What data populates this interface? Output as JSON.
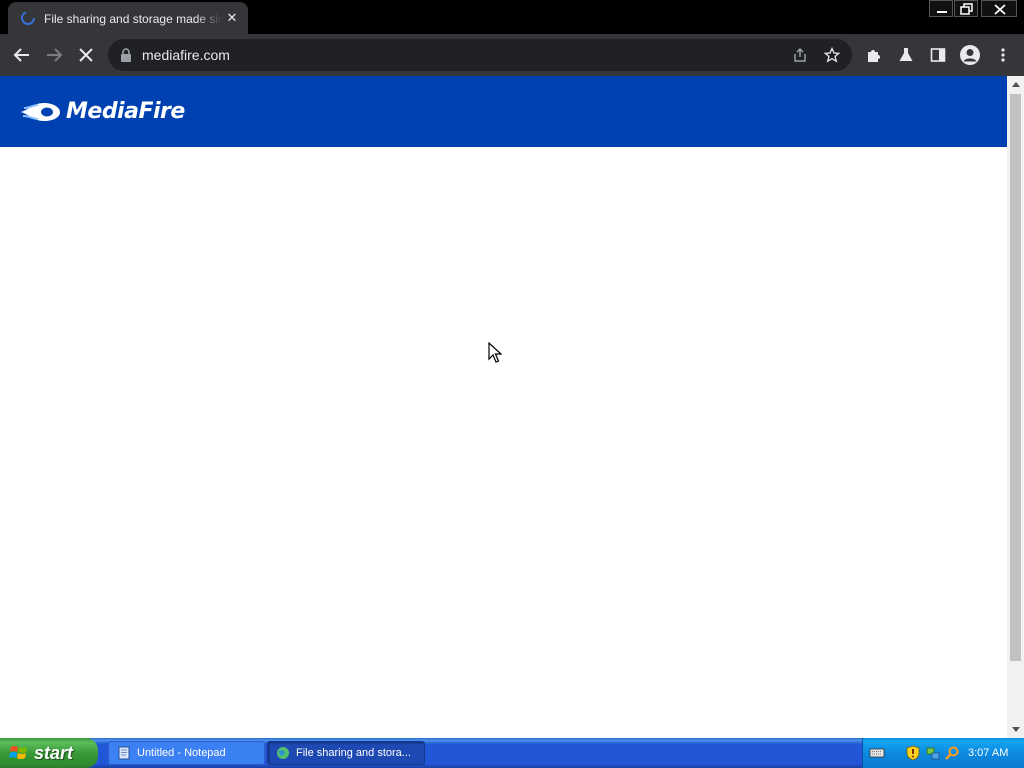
{
  "browser": {
    "tab_title": "File sharing and storage made simple",
    "tab_close_label": "✕",
    "url": "mediafire.com",
    "page_loading": true
  },
  "page": {
    "logo_text": "MediaFire",
    "header_color": "#0041b2"
  },
  "taskbar": {
    "start_label": "start",
    "tasks": [
      {
        "label": "Untitled - Notepad",
        "active": false
      },
      {
        "label": "File sharing and stora...",
        "active": true
      }
    ],
    "clock": "3:07 AM"
  },
  "icons": {
    "back": "arrow-left-icon",
    "forward": "arrow-right-icon",
    "stop": "close-icon",
    "lock": "lock-icon",
    "share": "share-icon",
    "bookmark": "star-icon",
    "extensions": "puzzle-icon",
    "labs": "flask-icon",
    "side_panel": "side-panel-icon",
    "profile": "profile-icon",
    "menu": "kebab-menu-icon"
  }
}
